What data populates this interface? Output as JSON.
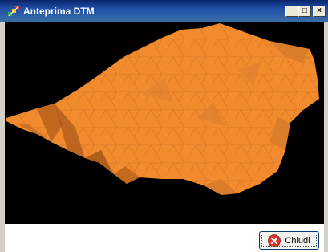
{
  "window": {
    "title": "Anteprima DTM",
    "controls": {
      "minimize": "_",
      "maximize": "□",
      "close": "×"
    }
  },
  "viewport": {
    "background": "#000000",
    "mesh_color": "#f28a2e",
    "mesh_shadow": "#b8621c"
  },
  "footer": {
    "close_button_label": "Chiudi"
  },
  "colors": {
    "titlebar": "#0a246a",
    "close_icon": "#d9372b"
  }
}
